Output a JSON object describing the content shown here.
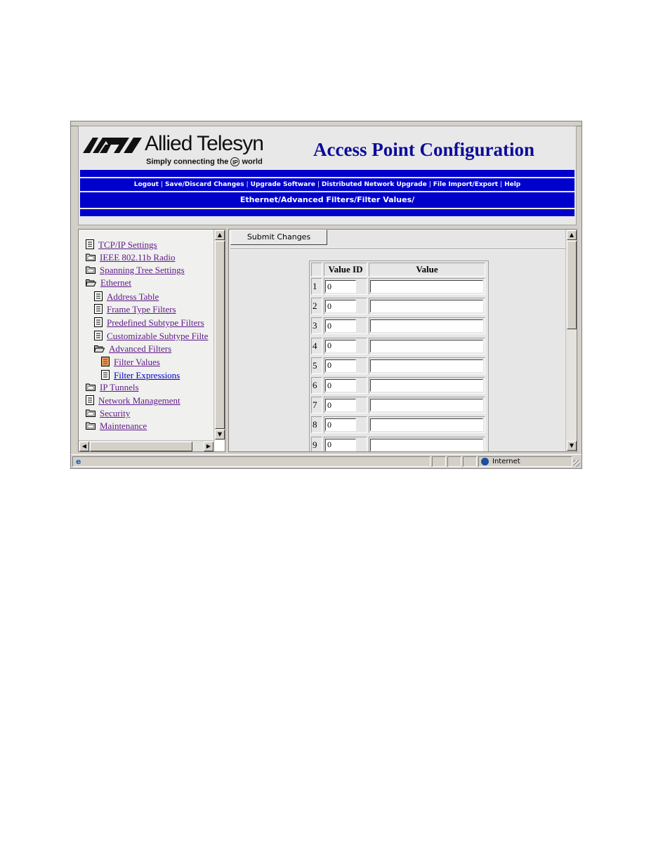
{
  "header": {
    "logo_name": "Allied Telesyn",
    "logo_tagline_pre": "Simply connecting the",
    "logo_tagline_ip": "IP",
    "logo_tagline_post": "world",
    "title": "Access Point Configuration"
  },
  "nav": {
    "links": [
      "Logout",
      "Save/Discard Changes",
      "Upgrade Software",
      "Distributed Network Upgrade",
      "File Import/Export",
      "Help"
    ]
  },
  "breadcrumb": "Ethernet/Advanced Filters/Filter Values/",
  "tree": [
    {
      "label": "TCP/IP Settings",
      "icon": "page-icon",
      "indent": 0
    },
    {
      "label": "IEEE 802.11b Radio",
      "icon": "folder-closed-icon",
      "indent": 0
    },
    {
      "label": "Spanning Tree Settings",
      "icon": "folder-closed-icon",
      "indent": 0
    },
    {
      "label": "Ethernet",
      "icon": "folder-open-icon",
      "indent": 0
    },
    {
      "label": "Address Table",
      "icon": "page-icon",
      "indent": 1
    },
    {
      "label": "Frame Type Filters",
      "icon": "page-icon",
      "indent": 1
    },
    {
      "label": "Predefined Subtype Filters",
      "icon": "page-icon",
      "indent": 1
    },
    {
      "label": "Customizable Subtype Filte",
      "icon": "page-icon",
      "indent": 1
    },
    {
      "label": "Advanced Filters",
      "icon": "folder-open-icon",
      "indent": 1
    },
    {
      "label": "Filter Values",
      "icon": "page-selected-icon",
      "indent": 2
    },
    {
      "label": "Filter Expressions",
      "icon": "page-icon",
      "indent": 2
    },
    {
      "label": "IP Tunnels",
      "icon": "folder-closed-icon",
      "indent": 0
    },
    {
      "label": "Network Management",
      "icon": "page-icon",
      "indent": 0
    },
    {
      "label": "Security",
      "icon": "folder-closed-icon",
      "indent": 0
    },
    {
      "label": "Maintenance",
      "icon": "folder-closed-icon",
      "indent": 0
    }
  ],
  "form": {
    "submit_label": "Submit Changes",
    "col_id": "Value ID",
    "col_value": "Value",
    "rows": [
      {
        "num": "1",
        "id": "0",
        "value": ""
      },
      {
        "num": "2",
        "id": "0",
        "value": ""
      },
      {
        "num": "3",
        "id": "0",
        "value": ""
      },
      {
        "num": "4",
        "id": "0",
        "value": ""
      },
      {
        "num": "5",
        "id": "0",
        "value": ""
      },
      {
        "num": "6",
        "id": "0",
        "value": ""
      },
      {
        "num": "7",
        "id": "0",
        "value": ""
      },
      {
        "num": "8",
        "id": "0",
        "value": ""
      },
      {
        "num": "9",
        "id": "0",
        "value": ""
      }
    ]
  },
  "status": {
    "zone": "Internet"
  },
  "colors": {
    "brand_blue": "#0000cc",
    "title_blue": "#0b0b9a",
    "link_visited": "#5e1a8a",
    "link": "#0000cc"
  }
}
